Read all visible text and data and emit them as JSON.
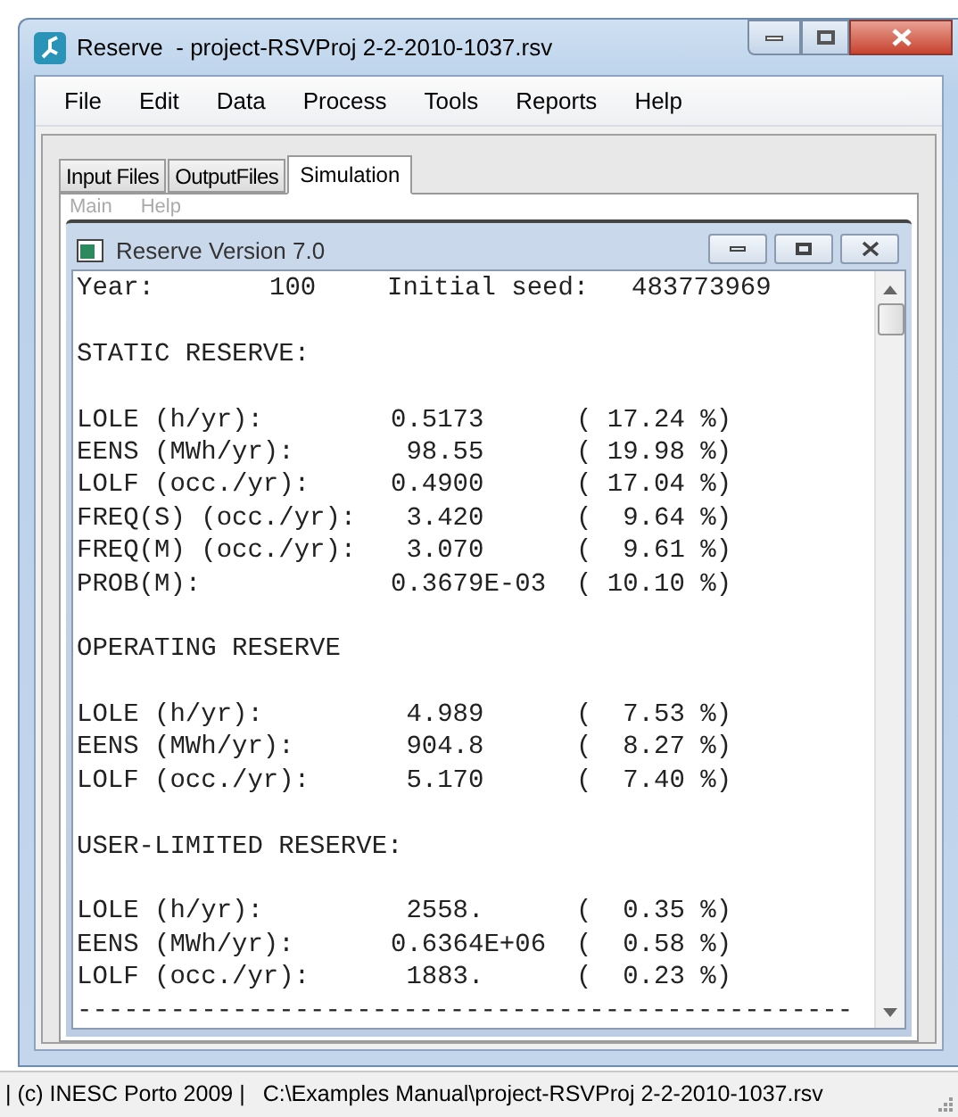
{
  "window": {
    "title": "Reserve  - project-RSVProj 2-2-2010-1037.rsv"
  },
  "menu": [
    "File",
    "Edit",
    "Data",
    "Process",
    "Tools",
    "Reports",
    "Help"
  ],
  "tabs": [
    {
      "label": "Input Files",
      "selected": false
    },
    {
      "label": "OutputFiles",
      "selected": false
    },
    {
      "label": "Simulation",
      "selected": true
    }
  ],
  "child_menu": [
    "Main",
    "Help"
  ],
  "child_window": {
    "title": "Reserve Version 7.0"
  },
  "report": {
    "header": {
      "year_label": "Year:",
      "year": "100",
      "seed_label": "Initial seed:",
      "seed": "483773969"
    },
    "sections": [
      {
        "title": "STATIC RESERVE:",
        "rows": [
          {
            "label": "LOLE (h/yr):",
            "value": "0.5173",
            "percent": "( 17.24 %)"
          },
          {
            "label": "EENS (MWh/yr):",
            "value": " 98.55",
            "percent": "( 19.98 %)"
          },
          {
            "label": "LOLF (occ./yr):",
            "value": "0.4900",
            "percent": "( 17.04 %)"
          },
          {
            "label": "FREQ(S) (occ./yr):",
            "value": " 3.420",
            "percent": "(  9.64 %)"
          },
          {
            "label": "FREQ(M) (occ./yr):",
            "value": " 3.070",
            "percent": "(  9.61 %)"
          },
          {
            "label": "PROB(M):",
            "value": "0.3679E-03",
            "percent": "( 10.10 %)"
          }
        ]
      },
      {
        "title": "OPERATING RESERVE",
        "rows": [
          {
            "label": "LOLE (h/yr):",
            "value": " 4.989",
            "percent": "(  7.53 %)"
          },
          {
            "label": "EENS (MWh/yr):",
            "value": " 904.8",
            "percent": "(  8.27 %)"
          },
          {
            "label": "LOLF (occ./yr):",
            "value": " 5.170",
            "percent": "(  7.40 %)"
          }
        ]
      },
      {
        "title": "USER-LIMITED RESERVE:",
        "rows": [
          {
            "label": "LOLE (h/yr):",
            "value": " 2558.",
            "percent": "(  0.35 %)"
          },
          {
            "label": "EENS (MWh/yr):",
            "value": "0.6364E+06",
            "percent": "(  0.58 %)"
          },
          {
            "label": "LOLF (occ./yr):",
            "value": " 1883.",
            "percent": "(  0.23 %)"
          }
        ]
      }
    ],
    "separator": "--------------------------------------------------"
  },
  "status_bar": {
    "copyright": "| (c) INESC Porto 2009 |",
    "path": "C:\\Examples Manual\\project-RSVProj 2-2-2010-1037.rsv"
  }
}
